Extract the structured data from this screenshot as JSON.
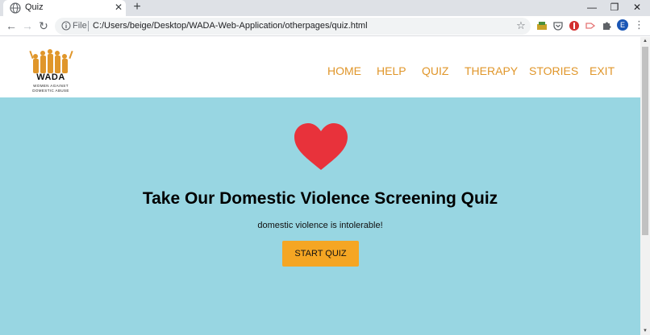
{
  "browser": {
    "tab_title": "Quiz",
    "tab_close": "✕",
    "new_tab": "+",
    "window_controls": {
      "minimize": "—",
      "restore": "❐",
      "close": "✕"
    },
    "nav": {
      "back": "←",
      "forward": "→",
      "reload": "↻"
    },
    "address": {
      "file_label": "File",
      "url": "C:/Users/beige/Desktop/WADA-Web-Application/otherpages/quiz.html"
    },
    "bookmark_star": "☆",
    "profile_initial": "E",
    "menu": "⋮"
  },
  "site": {
    "logo": {
      "name": "WADA",
      "line1": "WOMEN AGAINST",
      "line2": "DOMESTIC ABUSE"
    },
    "nav": [
      "HOME",
      "HELP",
      "QUIZ",
      "THERAPY",
      "STORIES",
      "EXIT"
    ],
    "hero": {
      "title": "Take Our Domestic Violence Screening Quiz",
      "subtitle": "domestic violence is intolerable!",
      "button_label": "START QUIZ"
    }
  },
  "colors": {
    "accent": "#e0962a",
    "hero_bg": "#98d6e2",
    "heart": "#e8323b",
    "button_bg": "#f5a623"
  },
  "scrollbar": {
    "up": "▲",
    "down": "▼"
  }
}
